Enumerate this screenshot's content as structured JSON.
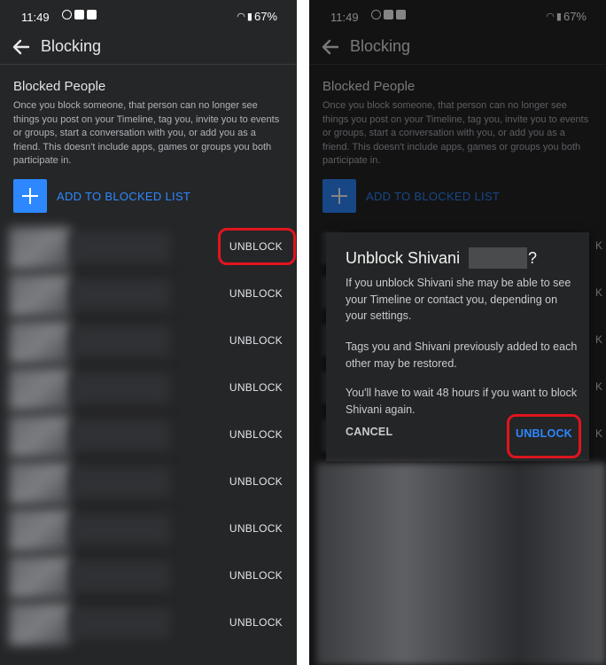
{
  "status_bar": {
    "time": "11:49",
    "battery": "67%"
  },
  "app_bar": {
    "title": "Blocking"
  },
  "section": {
    "title": "Blocked People",
    "description": "Once you block someone, that person can no longer see things you post on your Timeline, tag you, invite you to events or groups, start a conversation with you, or add you as a friend. This doesn't include apps, games or groups you both participate in."
  },
  "add_button": {
    "label": "ADD TO BLOCKED LIST"
  },
  "blocked_list": {
    "unblock_labels": [
      "UNBLOCK",
      "UNBLOCK",
      "UNBLOCK",
      "UNBLOCK",
      "UNBLOCK",
      "UNBLOCK",
      "UNBLOCK",
      "UNBLOCK",
      "UNBLOCK"
    ]
  },
  "dialog": {
    "title": "Unblock Shivani",
    "title_suffix": "?",
    "paragraph_1": "If you unblock Shivani she may be able to see your Timeline or contact you, depending on your settings.",
    "paragraph_2": "Tags you and Shivani previously added to each other may be restored.",
    "paragraph_3": "You'll have to wait 48 hours if you want to block Shivani again.",
    "cancel_label": "CANCEL",
    "unblock_label": "UNBLOCK"
  },
  "colors": {
    "accent": "#2d88ff",
    "highlight": "#e0151e",
    "background": "#252628"
  }
}
